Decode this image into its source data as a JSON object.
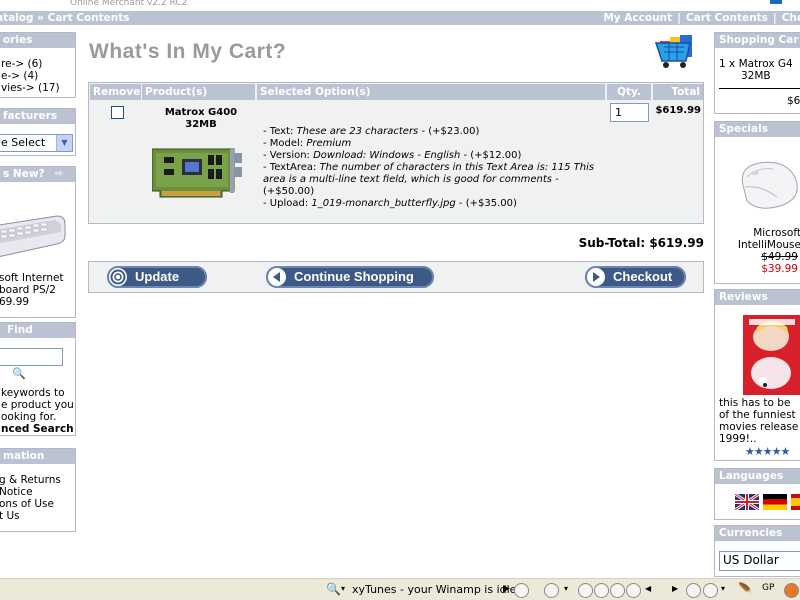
{
  "header": {
    "version": "Online Merchant v2.2 RC2",
    "breadcrumb": "atalog » Cart Contents",
    "nav": [
      "My Account",
      "Cart Contents",
      "Che"
    ]
  },
  "left": {
    "categories": {
      "title": "ories",
      "items": [
        "re-> (6)",
        "e-> (4)",
        "vies-> (17)"
      ]
    },
    "manufacturers": {
      "title": "facturers",
      "select_value": "e Select"
    },
    "whats_new": {
      "title": "s New?",
      "product_lines": [
        "soft Internet",
        "board PS/2"
      ],
      "price": "69.99"
    },
    "find": {
      "title": "Find",
      "desc": [
        "keywords to",
        "e product you",
        "ooking for."
      ],
      "advanced": "nced Search"
    },
    "information": {
      "title": "mation",
      "items": [
        "g & Returns",
        "Notice",
        "ons of Use",
        "t Us"
      ]
    }
  },
  "main": {
    "title": "What's In My Cart?",
    "table": {
      "headers": [
        "Remove",
        "Product(s)",
        "Selected Option(s)",
        "Qty.",
        "Total"
      ],
      "product_name": [
        "Matrox G400",
        "32MB"
      ],
      "options": [
        {
          "label": "- Text: ",
          "value": "These are 23 characters",
          "price": " - (+$23.00)"
        },
        {
          "label": "- Model: ",
          "value": "Premium",
          "price": ""
        },
        {
          "label": "- Version: ",
          "value": "Download: Windows - English",
          "price": " - (+$12.00)"
        },
        {
          "label": "- TextArea: ",
          "value": "The number of characters in this Text Area is: 115 This",
          "price": ""
        },
        {
          "label": "",
          "value": "area is a multi-line text field, which is good for comments",
          "price": " - (+$50.00)"
        },
        {
          "label": "- Upload: ",
          "value": "1_019-monarch_butterfly.jpg",
          "price": " - (+$35.00)"
        }
      ],
      "qty": "1",
      "total": "$619.99"
    },
    "subtotal": "Sub-Total: $619.99",
    "buttons": {
      "update": "Update",
      "continue": "Continue Shopping",
      "checkout": "Checkout"
    }
  },
  "right": {
    "shopping_cart": {
      "title": "Shopping Car",
      "line1": "1 x Matrox G4",
      "line2": "32MB",
      "total": "$6"
    },
    "specials": {
      "title": "Specials",
      "name1": "Microsoft",
      "name2": "IntelliMouse",
      "old_price": "$49.99",
      "new_price": "$39.99"
    },
    "reviews": {
      "title": "Reviews",
      "text": [
        "this has to be",
        "of the funniest",
        "movies release",
        "1999!.."
      ],
      "stars": "★★★★★"
    },
    "languages": {
      "title": "Languages"
    },
    "currencies": {
      "title": "Currencies",
      "value": "US Dollar"
    }
  },
  "taskbar": {
    "xytunes": "xyTunes - your Winamp is idle",
    "gp": "GP"
  },
  "colors": {
    "header_bar": "#bbc3d3",
    "title_gray": "#9a9a9a",
    "button_blue": "#3d5a86",
    "special_red": "#cc0000"
  }
}
